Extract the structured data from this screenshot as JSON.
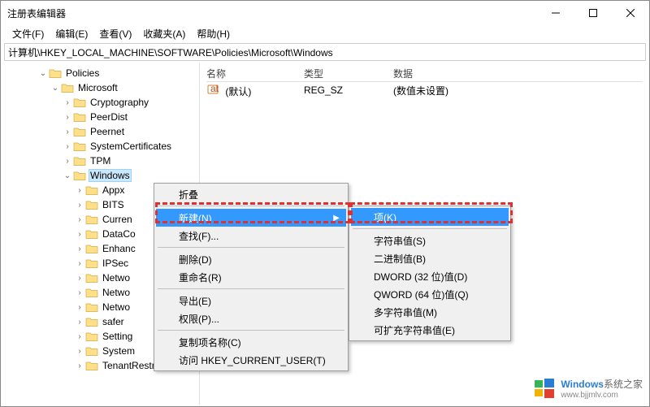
{
  "window": {
    "title": "注册表编辑器"
  },
  "menu": {
    "file": "文件(F)",
    "edit": "编辑(E)",
    "view": "查看(V)",
    "fav": "收藏夹(A)",
    "help": "帮助(H)"
  },
  "address": "计算机\\HKEY_LOCAL_MACHINE\\SOFTWARE\\Policies\\Microsoft\\Windows",
  "tree": {
    "policies": "Policies",
    "microsoft": "Microsoft",
    "items": [
      "Cryptography",
      "PeerDist",
      "Peernet",
      "SystemCertificates",
      "TPM",
      "Windows"
    ],
    "windows_children": [
      "Appx",
      "BITS",
      "Curren",
      "DataCo",
      "Enhanc",
      "IPSec",
      "Netwo",
      "Netwo",
      "Netwo",
      "safer",
      "Setting",
      "System",
      "TenantRestriction"
    ]
  },
  "list": {
    "headers": {
      "name": "名称",
      "type": "类型",
      "data": "数据"
    },
    "row": {
      "name": "(默认)",
      "type": "REG_SZ",
      "data": "(数值未设置)"
    }
  },
  "ctx": {
    "collapse": "折叠",
    "new": "新建(N)",
    "find": "查找(F)...",
    "delete": "删除(D)",
    "rename": "重命名(R)",
    "export": "导出(E)",
    "perm": "权限(P)...",
    "copykey": "复制项名称(C)",
    "gotohkcu": "访问 HKEY_CURRENT_USER(T)"
  },
  "sub": {
    "key": "项(K)",
    "string": "字符串值(S)",
    "binary": "二进制值(B)",
    "dword": "DWORD (32 位)值(D)",
    "qword": "QWORD (64 位)值(Q)",
    "multi": "多字符串值(M)",
    "expand": "可扩充字符串值(E)"
  },
  "watermark": {
    "brand": "Windows",
    "suffix": "系统之家",
    "url": "www.bjjmlv.com"
  }
}
